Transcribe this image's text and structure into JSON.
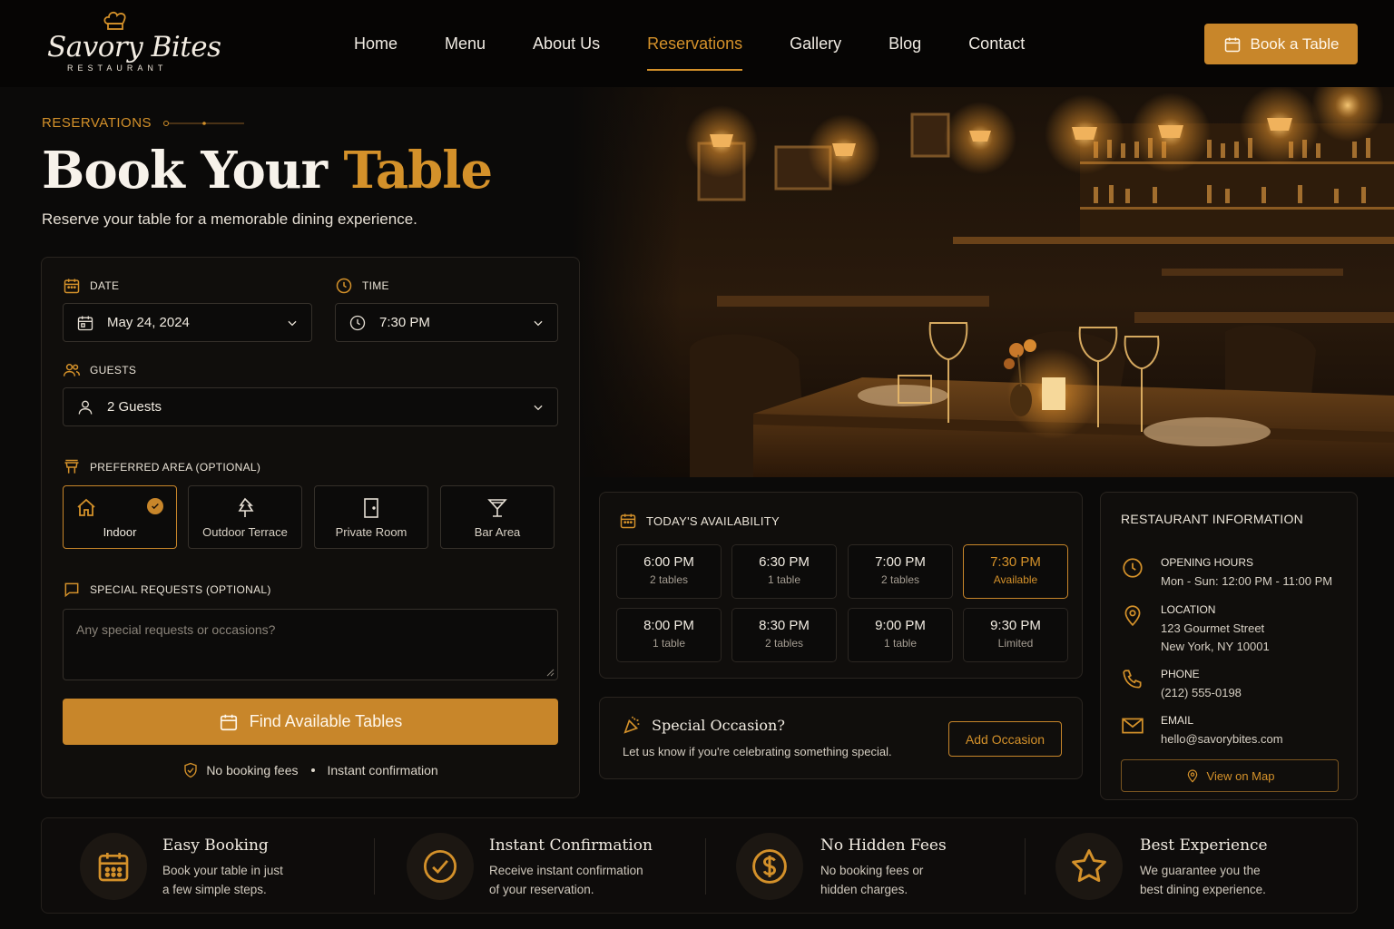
{
  "brand": {
    "name": "Savory Bites",
    "tagline": "RESTAURANT"
  },
  "nav": {
    "items": [
      {
        "label": "Home",
        "active": false
      },
      {
        "label": "Menu",
        "active": false
      },
      {
        "label": "About Us",
        "active": false
      },
      {
        "label": "Reservations",
        "active": true
      },
      {
        "label": "Gallery",
        "active": false
      },
      {
        "label": "Blog",
        "active": false
      },
      {
        "label": "Contact",
        "active": false
      }
    ],
    "cta_label": "Book a Table"
  },
  "hero": {
    "eyebrow": "RESERVATIONS",
    "title_part1": "Book Your",
    "title_part2": "Table",
    "subtitle": "Reserve your table for a memorable dining experience."
  },
  "form": {
    "date_label": "DATE",
    "date_value": "May 24, 2024",
    "time_label": "TIME",
    "time_value": "7:30 PM",
    "guests_label": "GUESTS",
    "guests_value": "2 Guests",
    "area_label": "PREFERRED AREA (OPTIONAL)",
    "areas": [
      {
        "label": "Indoor",
        "icon": "house-icon",
        "selected": true
      },
      {
        "label": "Outdoor Terrace",
        "icon": "tree-icon",
        "selected": false
      },
      {
        "label": "Private Room",
        "icon": "door-icon",
        "selected": false
      },
      {
        "label": "Bar Area",
        "icon": "cocktail-icon",
        "selected": false
      }
    ],
    "requests_label": "SPECIAL REQUESTS (OPTIONAL)",
    "requests_placeholder": "Any special requests or occasions?",
    "submit_label": "Find Available Tables",
    "assurance_1": "No booking fees",
    "assurance_2": "Instant confirmation"
  },
  "availability": {
    "heading": "TODAY'S AVAILABILITY",
    "slots": [
      {
        "time": "6:00 PM",
        "status": "2 tables",
        "selected": false
      },
      {
        "time": "6:30 PM",
        "status": "1 table",
        "selected": false
      },
      {
        "time": "7:00 PM",
        "status": "2 tables",
        "selected": false
      },
      {
        "time": "7:30 PM",
        "status": "Available",
        "selected": true
      },
      {
        "time": "8:00 PM",
        "status": "1 table",
        "selected": false
      },
      {
        "time": "8:30 PM",
        "status": "2 tables",
        "selected": false
      },
      {
        "time": "9:00 PM",
        "status": "1 table",
        "selected": false
      },
      {
        "time": "9:30 PM",
        "status": "Limited",
        "selected": false
      }
    ]
  },
  "occasion": {
    "title": "Special Occasion?",
    "subtitle": "Let us know if you're celebrating something special.",
    "button_label": "Add Occasion"
  },
  "info": {
    "heading": "RESTAURANT INFORMATION",
    "hours_label": "OPENING HOURS",
    "hours_value": "Mon - Sun: 12:00 PM - 11:00 PM",
    "location_label": "LOCATION",
    "location_line1": "123 Gourmet Street",
    "location_line2": "New York, NY 10001",
    "phone_label": "PHONE",
    "phone_value": "(212) 555-0198",
    "email_label": "EMAIL",
    "email_value": "hello@savorybites.com",
    "map_button": "View on Map"
  },
  "features": [
    {
      "title": "Easy Booking",
      "line1": "Book your table in just",
      "line2": "a few simple steps.",
      "icon": "calendar-icon"
    },
    {
      "title": "Instant Confirmation",
      "line1": "Receive instant confirmation",
      "line2": "of your reservation.",
      "icon": "check-circle-icon"
    },
    {
      "title": "No Hidden Fees",
      "line1": "No booking fees or",
      "line2": "hidden charges.",
      "icon": "dollar-icon"
    },
    {
      "title": "Best Experience",
      "line1": "We guarantee you the",
      "line2": "best dining experience.",
      "icon": "star-icon"
    }
  ],
  "colors": {
    "accent": "#c8862a",
    "background": "#0b0a09",
    "card": "#100e0c"
  }
}
